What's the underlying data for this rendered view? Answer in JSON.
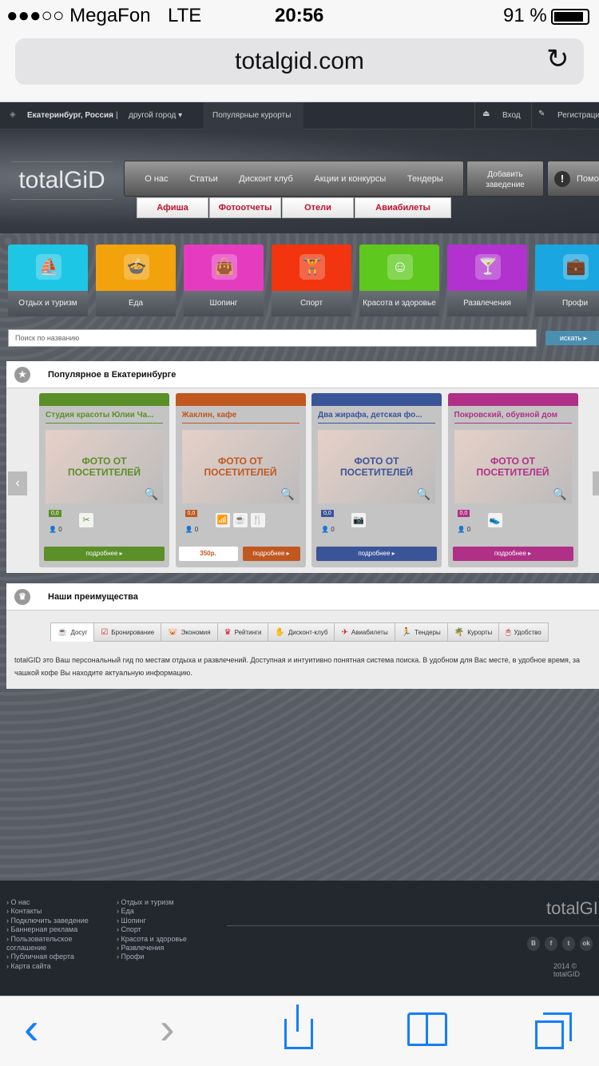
{
  "status": {
    "carrier": "●●●○○ MegaFon",
    "network": "LTE",
    "time": "20:56",
    "battery": "91 %"
  },
  "browser": {
    "url": "totalgid.com",
    "reload_icon": "↻",
    "back_icon": "‹",
    "forward_icon": "›"
  },
  "topbar": {
    "city": "Екатеринбург, Россия",
    "sep": "|",
    "other_city": "другой город ▾",
    "resorts": "Популярные курорты",
    "login": "Вход",
    "register": "Регистрация"
  },
  "header": {
    "logo": "totalGiD",
    "nav": [
      "О нас",
      "Статьи",
      "Дисконт клуб",
      "Акции и конкурсы",
      "Тендеры"
    ],
    "add_place_1": "Добавить",
    "add_place_2": "заведение",
    "help": "Помощь",
    "sub": [
      "Афиша",
      "Фотоотчеты",
      "Отели",
      "Авиабилеты"
    ]
  },
  "categories": [
    {
      "label": "Отдых и туризм",
      "color": "#1ec6e6",
      "icon": "⛵"
    },
    {
      "label": "Еда",
      "color": "#f2a20a",
      "icon": "🍲"
    },
    {
      "label": "Шопинг",
      "color": "#e53cbf",
      "icon": "👜"
    },
    {
      "label": "Спорт",
      "color": "#f2350e",
      "icon": "🏋"
    },
    {
      "label": "Красота и здоровье",
      "color": "#5ec81e",
      "icon": "☺"
    },
    {
      "label": "Развлечения",
      "color": "#b232d0",
      "icon": "🍸"
    },
    {
      "label": "Профи",
      "color": "#1aa6e0",
      "icon": "💼"
    }
  ],
  "search": {
    "placeholder": "Поиск по названию",
    "button": "искать ▸"
  },
  "popular": {
    "title": "Популярное в Екатеринбурге",
    "photo_1": "ФОТО ОТ",
    "photo_2": "ПОСЕТИТЕЛЕЙ",
    "more": "подробнее ▸",
    "cards": [
      {
        "title": "Студия красоты Юлии Ча...",
        "rating": "0,0",
        "users": "0",
        "color": "#5b8f28",
        "icons": [
          "✂"
        ]
      },
      {
        "title": "Жаклин, кафе",
        "rating": "0,0",
        "users": "0",
        "color": "#c05820",
        "icons": [
          "📶",
          "☕",
          "🍴"
        ],
        "price": "350р."
      },
      {
        "title": "Два жирафа, детская фо...",
        "rating": "0,0",
        "users": "0",
        "color": "#3a5597",
        "icons": [
          "📷"
        ]
      },
      {
        "title": "Покровский, обувной дом",
        "rating": "0,0",
        "users": "0",
        "color": "#b03088",
        "icons": [
          "👟"
        ]
      }
    ]
  },
  "advantages": {
    "title": "Наши преимущества",
    "tabs": [
      {
        "label": "Досуг",
        "icon": "☕"
      },
      {
        "label": "Бронирование",
        "icon": "☑"
      },
      {
        "label": "Экономия",
        "icon": "🐷"
      },
      {
        "label": "Рейтинги",
        "icon": "♛"
      },
      {
        "label": "Дисконт-клуб",
        "icon": "✋"
      },
      {
        "label": "Авиабилеты",
        "icon": "✈"
      },
      {
        "label": "Тендеры",
        "icon": "🏃"
      },
      {
        "label": "Курорты",
        "icon": "🌴"
      },
      {
        "label": "Удобство",
        "icon": "🖱"
      }
    ],
    "text": "totalGID это Ваш персональный гид по местам отдыха и развлечений. Доступная и интуитивно понятная система поиска. В удобном для Вас месте, в удобное время, за чашкой кофе Вы находите актуальную информацию."
  },
  "footer": {
    "col1": [
      "О нас",
      "Контакты",
      "Подключить заведение",
      "Баннерная реклама",
      "Пользовательское соглашение",
      "Публичная оферта",
      "Карта сайта"
    ],
    "col2": [
      "Отдых и туризм",
      "Еда",
      "Шопинг",
      "Спорт",
      "Красота и здоровье",
      "Развлечения",
      "Профи"
    ],
    "logo": "totalGID",
    "social": [
      "В",
      "f",
      "t",
      "ok"
    ],
    "copyright": "2014 © totalGID"
  }
}
